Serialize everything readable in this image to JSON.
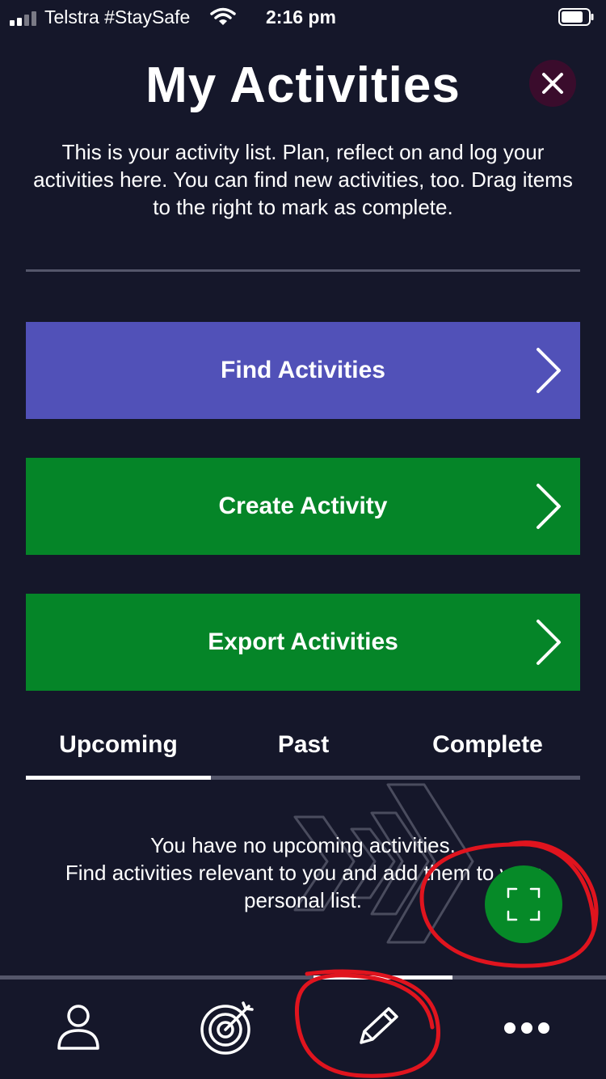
{
  "status_bar": {
    "carrier": "Telstra #StaySafe",
    "time": "2:16 pm",
    "signal_bars": 2,
    "battery_level": 0.8
  },
  "header": {
    "title": "My Activities",
    "close_icon": "close-icon"
  },
  "intro_text": "This is your activity list. Plan, reflect on and log your activities here. You can find new activities, too. Drag items to the right to mark as complete.",
  "actions": [
    {
      "label": "Find Activities",
      "color": "#5151b8",
      "icon": "chevron-right-icon"
    },
    {
      "label": "Create Activity",
      "color": "#058528",
      "icon": "chevron-right-icon"
    },
    {
      "label": "Export Activities",
      "color": "#058528",
      "icon": "chevron-right-icon"
    }
  ],
  "tabs": {
    "items": [
      {
        "label": "Upcoming"
      },
      {
        "label": "Past"
      },
      {
        "label": "Complete"
      }
    ],
    "selected": "Upcoming"
  },
  "empty_state": {
    "line1": "You have no upcoming activities.",
    "line2": "Find activities relevant to you and add them to your",
    "line3": "personal list."
  },
  "fab": {
    "icon": "scan-frame-icon",
    "color": "#068a28"
  },
  "bottom_nav": {
    "items": [
      {
        "icon": "profile-icon"
      },
      {
        "icon": "target-icon"
      },
      {
        "icon": "pencil-icon"
      },
      {
        "icon": "more-icon"
      }
    ],
    "selected": "pencil-icon"
  },
  "colors": {
    "background": "#15172a",
    "divider": "#54566a",
    "annotation": "#e0141e"
  }
}
